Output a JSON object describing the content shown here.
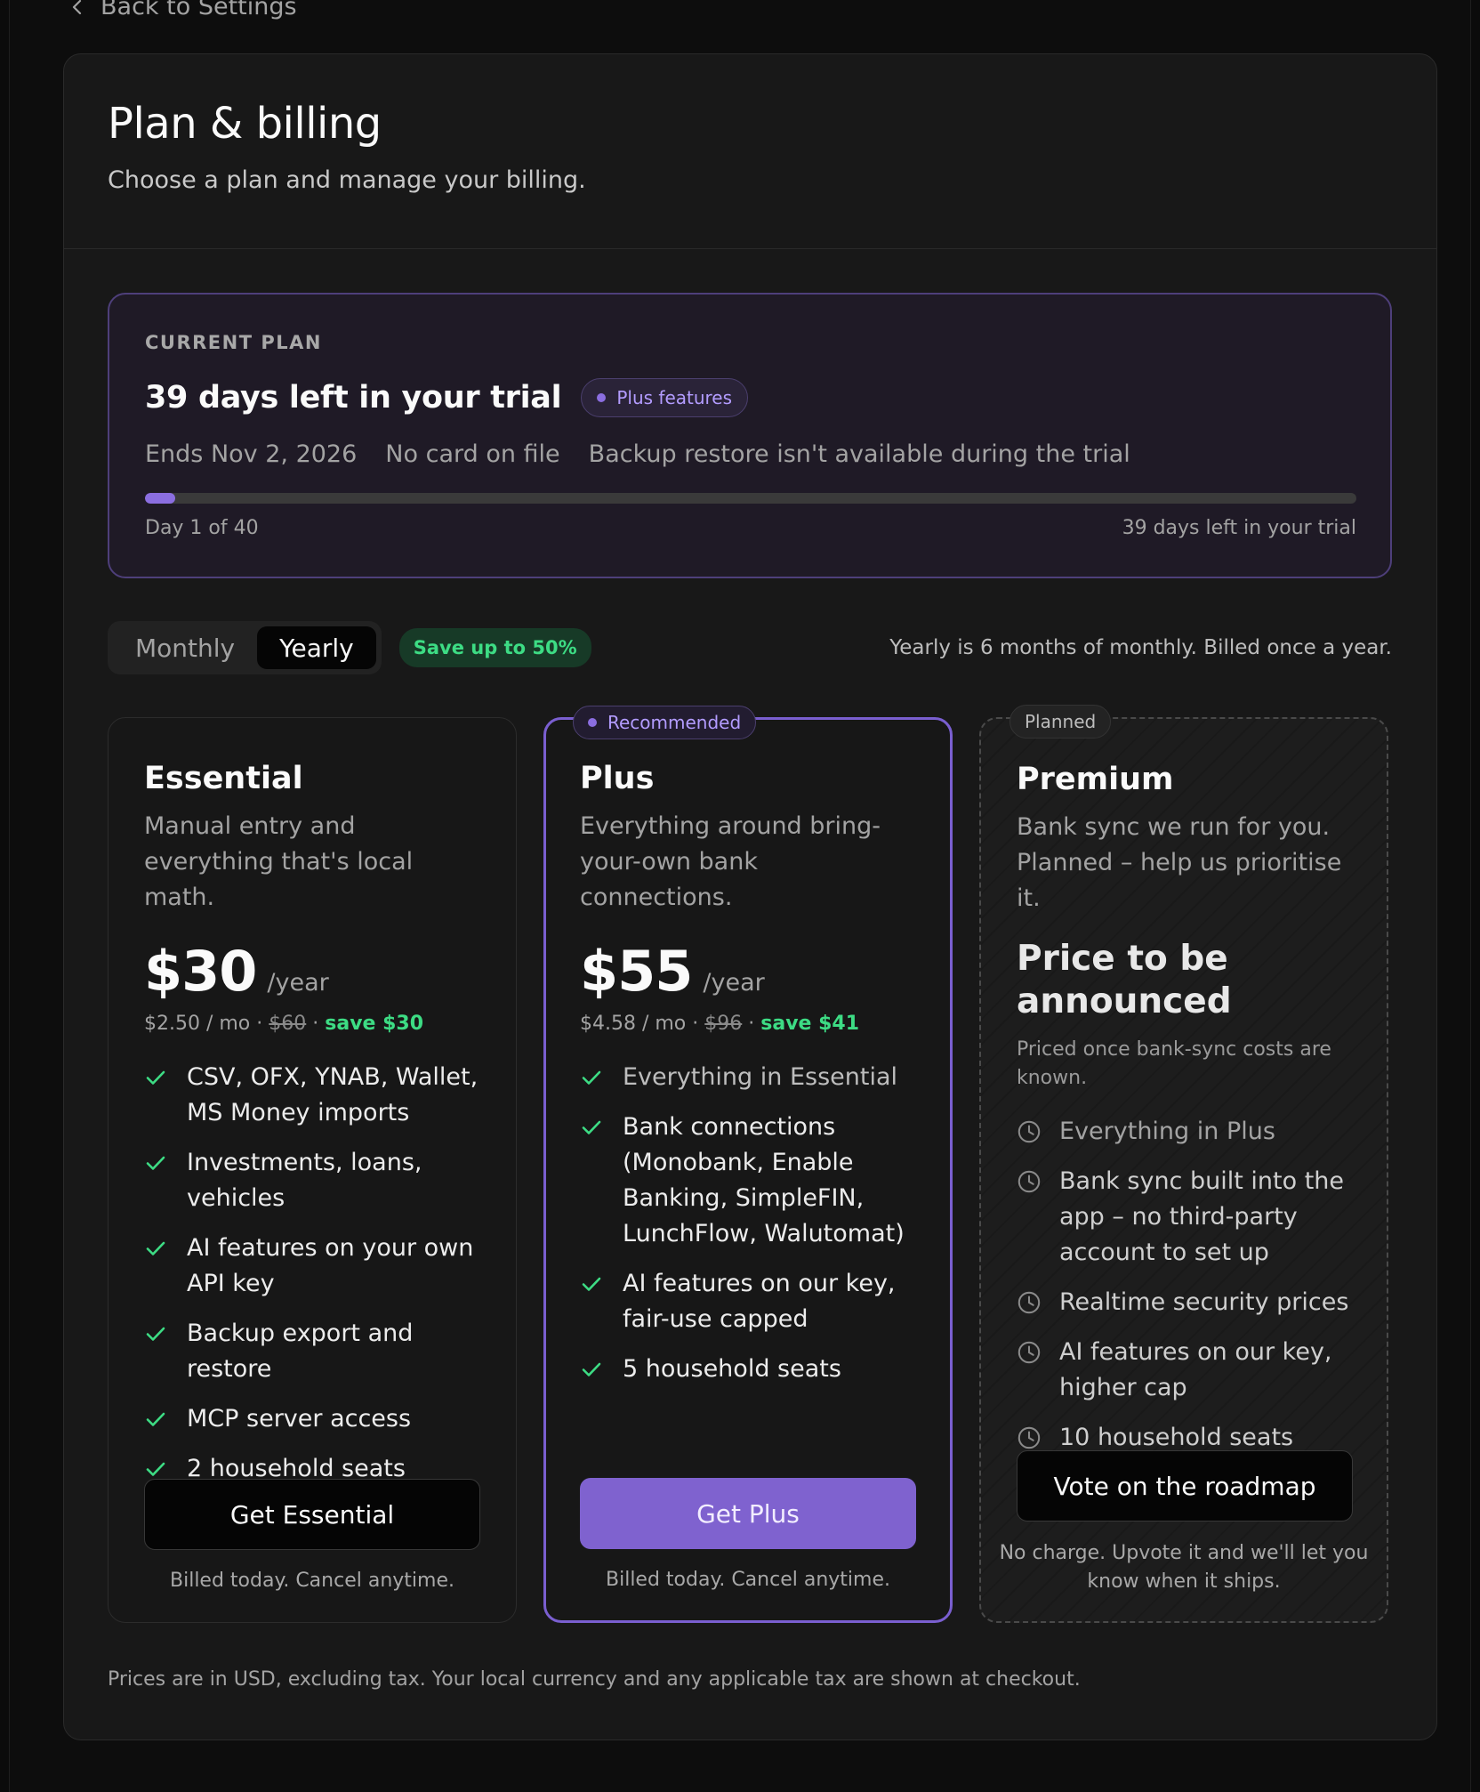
{
  "nav": {
    "back_label": "Back to Settings"
  },
  "header": {
    "title": "Plan & billing",
    "subtitle": "Choose a plan and manage your billing."
  },
  "current_plan": {
    "eyebrow": "CURRENT PLAN",
    "title": "39 days left in your trial",
    "badge": "Plus features",
    "meta": [
      "Ends Nov 2, 2026",
      "No card on file",
      "Backup restore isn't available during the trial"
    ],
    "progress_fraction": 0.025,
    "progress_left_label": "Day 1 of 40",
    "progress_right_label": "39 days left in your trial"
  },
  "billing": {
    "options": [
      "Monthly",
      "Yearly"
    ],
    "selected": "Yearly",
    "save_badge": "Save up to 50%",
    "note": "Yearly is 6 months of monthly. Billed once a year."
  },
  "plans": [
    {
      "name": "Essential",
      "description": "Manual entry and everything that's local math.",
      "price": "$30",
      "period": "/year",
      "monthly": "$2.50 / mo",
      "original": "$60",
      "save": "save $30",
      "features": [
        "CSV, OFX, YNAB, Wallet, MS Money imports",
        "Investments, loans, vehicles",
        "AI features on your own API key",
        "Backup export and restore",
        "MCP server access",
        "2 household seats"
      ],
      "cta": "Get Essential",
      "cta_note": "Billed today. Cancel anytime."
    },
    {
      "name": "Plus",
      "tag": "Recommended",
      "description": "Everything around bring-your-own bank connections.",
      "price": "$55",
      "period": "/year",
      "monthly": "$4.58 / mo",
      "original": "$96",
      "save": "save $41",
      "features": [
        "Everything in Essential",
        "Bank connections (Monobank, Enable Banking, SimpleFIN, LunchFlow, Walutomat)",
        "AI features on our key, fair-use capped",
        "5 household seats"
      ],
      "cta": "Get Plus",
      "cta_note": "Billed today. Cancel anytime."
    },
    {
      "name": "Premium",
      "tag": "Planned",
      "description": "Bank sync we run for you. Planned – help us prioritise it.",
      "price_tba": "Price to be announced",
      "price_note": "Priced once bank-sync costs are known.",
      "features": [
        "Everything in Plus",
        "Bank sync built into the app – no third-party account to set up",
        "Realtime security prices",
        "AI features on our key, higher cap",
        "10 household seats"
      ],
      "cta": "Vote on the roadmap",
      "cta_note": "No charge. Upvote it and we'll let you know when it ships."
    }
  ],
  "footer_note": "Prices are in USD, excluding tax. Your local currency and any applicable tax are shown at checkout.",
  "colors": {
    "accent": "#7f62cf",
    "success": "#3ddc84",
    "background": "#181818"
  },
  "icons": {
    "back": "chevron-left-icon",
    "check": "check-icon",
    "planned": "clock-icon"
  }
}
